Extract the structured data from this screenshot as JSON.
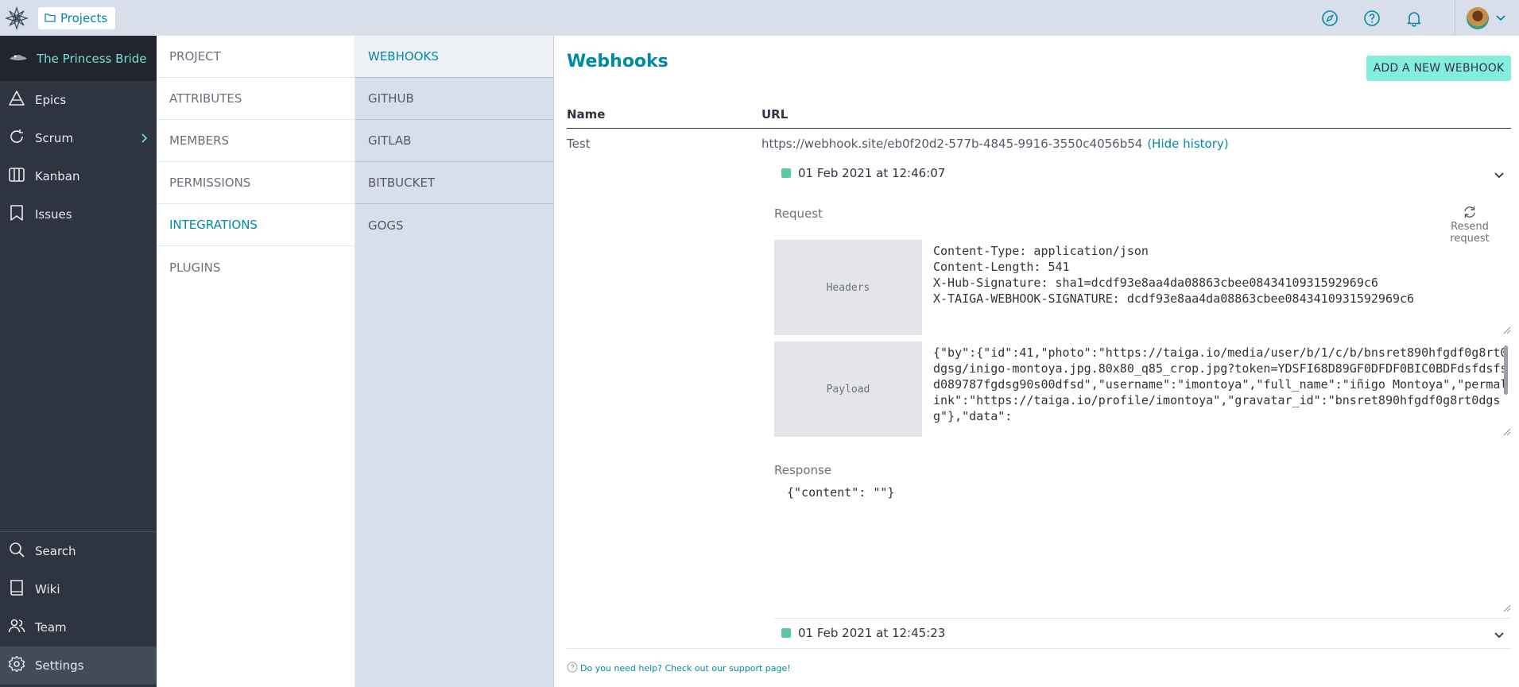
{
  "topbar": {
    "projects_label": "Projects"
  },
  "nav": {
    "project_name": "The Princess Bride",
    "items": [
      {
        "label": "Epics",
        "icon": "epics-icon"
      },
      {
        "label": "Scrum",
        "icon": "scrum-icon"
      },
      {
        "label": "Kanban",
        "icon": "kanban-icon"
      },
      {
        "label": "Issues",
        "icon": "issues-icon"
      }
    ],
    "bottom_items": [
      {
        "label": "Search",
        "icon": "search-icon"
      },
      {
        "label": "Wiki",
        "icon": "wiki-icon"
      },
      {
        "label": "Team",
        "icon": "team-icon"
      },
      {
        "label": "Settings",
        "icon": "gear-icon"
      }
    ]
  },
  "settings_menu": [
    "PROJECT",
    "ATTRIBUTES",
    "MEMBERS",
    "PERMISSIONS",
    "INTEGRATIONS",
    "PLUGINS"
  ],
  "integrations_menu": [
    "WEBHOOKS",
    "GITHUB",
    "GITLAB",
    "BITBUCKET",
    "GOGS"
  ],
  "main": {
    "title": "Webhooks",
    "add_button": "ADD A NEW WEBHOOK",
    "columns": {
      "name": "Name",
      "url": "URL"
    },
    "webhook": {
      "name": "Test",
      "url": "https://webhook.site/eb0f20d2-577b-4845-9916-3550c4056b54",
      "hide_history": "(Hide history)"
    },
    "history": [
      {
        "timestamp": "01 Feb 2021 at 12:46:07"
      },
      {
        "timestamp": "01 Feb 2021 at 12:45:23"
      }
    ],
    "request_label": "Request",
    "resend_label": "Resend request",
    "headers_label": "Headers",
    "headers_text": "Content-Type: application/json\nContent-Length: 541\nX-Hub-Signature: sha1=dcdf93e8aa4da08863cbee0843410931592969c6\nX-TAIGA-WEBHOOK-SIGNATURE: dcdf93e8aa4da08863cbee0843410931592969c6",
    "payload_label": "Payload",
    "payload_text": "{\"by\":{\"id\":41,\"photo\":\"https://taiga.io/media/user/b/1/c/b/bnsret890hfgdf0g8rt0dgsg/inigo-montoya.jpg.80x80_q85_crop.jpg?token=YDSFI68D89GF0DFDF0BIC0BDFdsfdsfsd089787fgdsg90s00dfsd\",\"username\":\"imontoya\",\"full_name\":\"iñigo Montoya\",\"permalink\":\"https://taiga.io/profile/imontoya\",\"gravatar_id\":\"bnsret890hfgdf0g8rt0dgsg\"},\"data\":",
    "response_label": "Response",
    "response_text": "{\"content\": \"\"}",
    "help_text": "Do you need help? Check out our support page!"
  }
}
